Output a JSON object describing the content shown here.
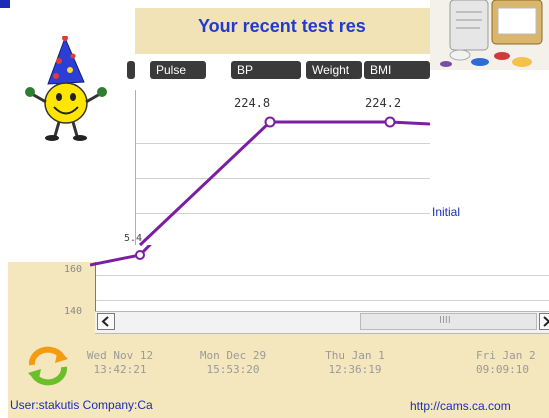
{
  "back_window": {
    "y_ticks": [
      "160",
      "140"
    ],
    "dates": [
      {
        "day": "Wed Nov 12",
        "time": "13:42:21"
      },
      {
        "day": "Mon Dec 29",
        "time": "15:53:20"
      },
      {
        "day": "Thu Jan 1",
        "time": "12:36:19"
      },
      {
        "day": "Fri Jan 2",
        "time": "09:09:10"
      }
    ],
    "footer_user": "User:stakutis Company:Ca",
    "footer_url": "http://cams.ca.com",
    "scroll_thumb_grip": "IIII",
    "partial_value": "5.4"
  },
  "front_window": {
    "title": "Your recent test res",
    "tabs": [
      "Pulse",
      "BP",
      "Weight",
      "BMI"
    ],
    "data_labels": [
      "224.8",
      "224.2"
    ],
    "line_color": "#7b1fa2"
  },
  "pills_window": {
    "initial_link": "Initial"
  },
  "icons": {
    "mascot": "party-smiley-icon",
    "refresh": "refresh-arrows-icon"
  }
}
